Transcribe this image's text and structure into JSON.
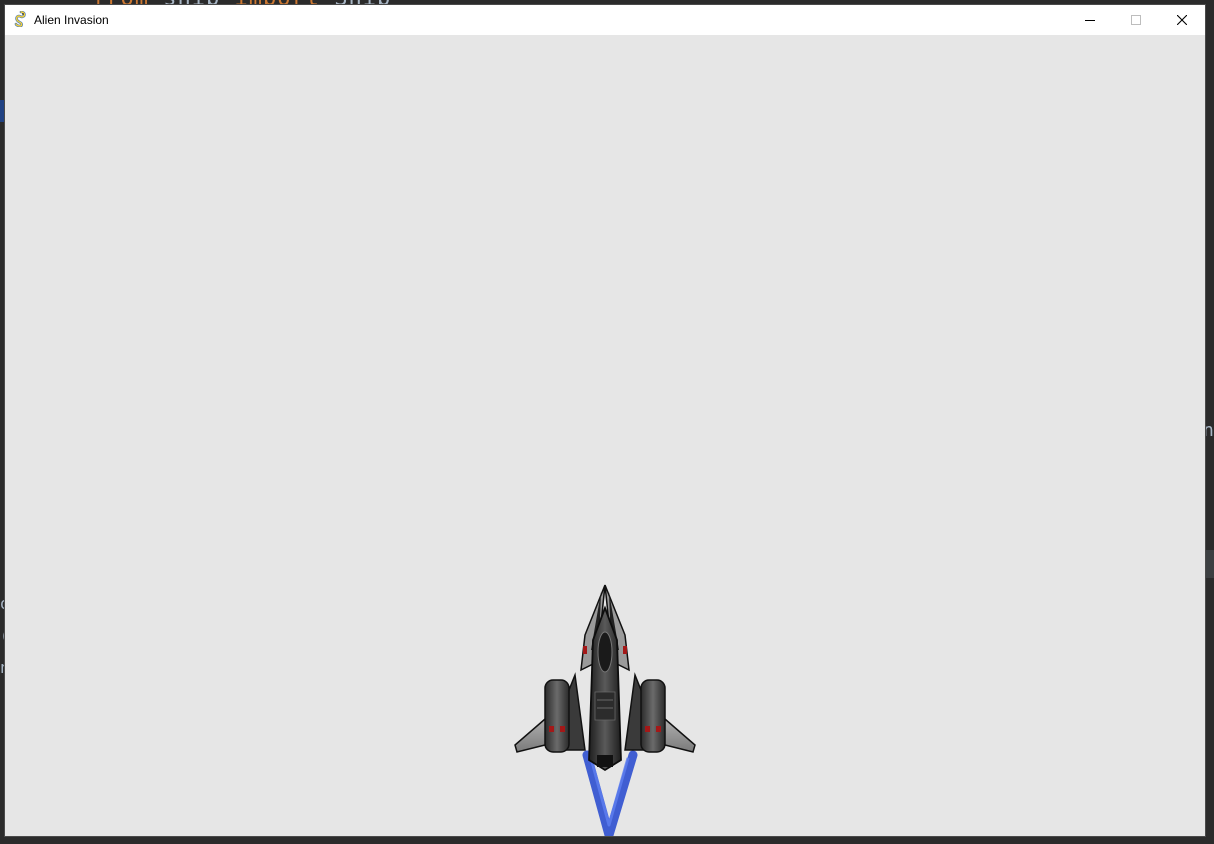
{
  "window": {
    "title": "Alien Invasion",
    "app_icon": "pygame-snake-icon",
    "controls": [
      "minimize",
      "maximize",
      "close"
    ]
  },
  "background_app": {
    "code_line_keyword1": "from",
    "code_line_module": "ship",
    "code_line_keyword2": "import",
    "code_line_name": "Ship",
    "right_glyph": "n",
    "left_glyphs": [
      "o",
      "(",
      "n"
    ]
  },
  "game": {
    "background_color": "#e6e6e6",
    "player": {
      "sprite": "ship",
      "thruster_color": "#2e4fcf"
    }
  }
}
